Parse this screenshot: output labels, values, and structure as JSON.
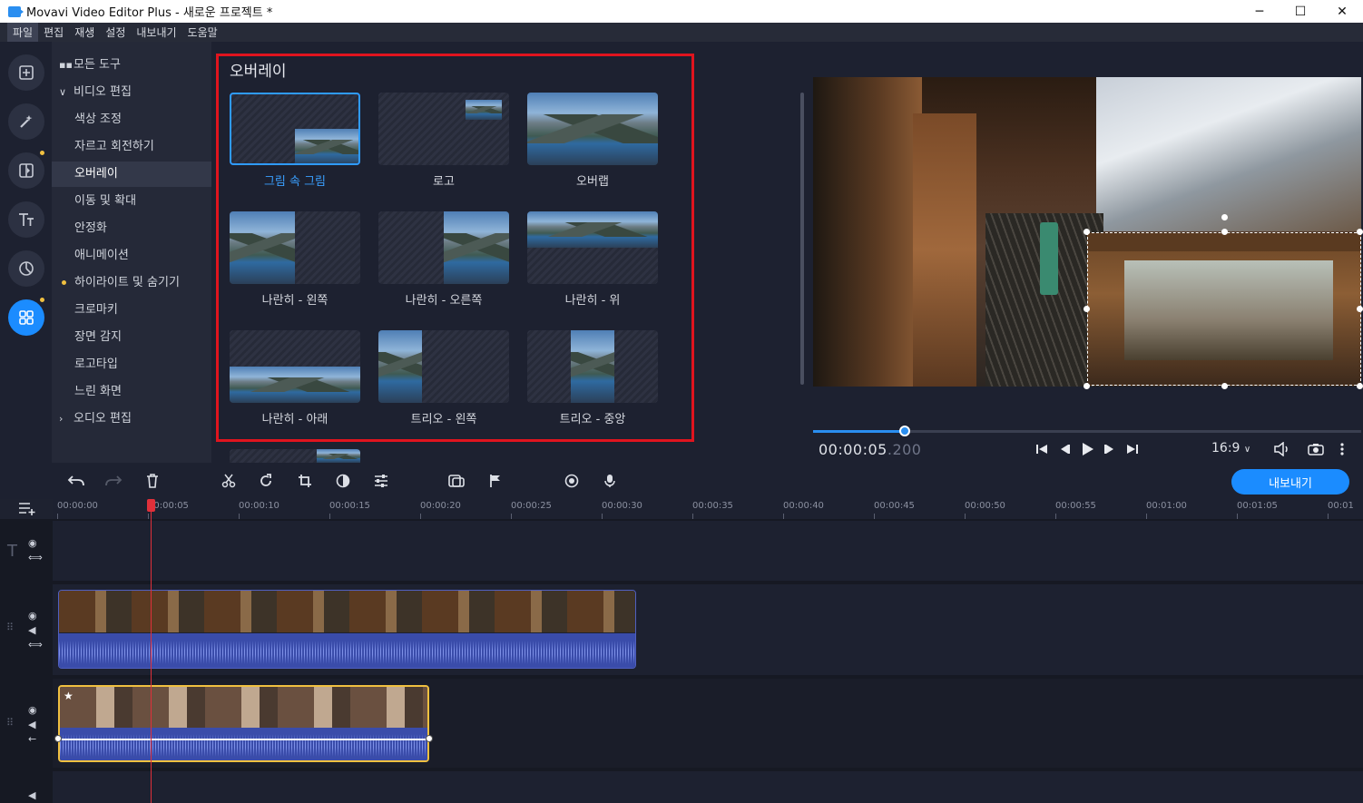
{
  "window": {
    "title": "Movavi Video Editor Plus - 새로운 프로젝트 *",
    "minimize": "─",
    "maximize": "☐",
    "close": "✕"
  },
  "menu": [
    "파일",
    "편집",
    "재생",
    "설정",
    "내보내기",
    "도움말"
  ],
  "rail_icons": [
    "import-icon",
    "magic-wand-icon",
    "transitions-icon",
    "titles-icon",
    "stickers-icon",
    "more-tools-icon"
  ],
  "tools": {
    "all_tools": "모든 도구",
    "video_edit": "비디오 편집",
    "items": [
      "색상 조정",
      "자르고 회전하기",
      "오버레이",
      "이동 및 확대",
      "안정화",
      "애니메이션",
      "하이라이트 및 숨기기",
      "크로마키",
      "장면 감지",
      "로고타입",
      "느린 화면"
    ],
    "audio_edit": "오디오 편집"
  },
  "overlay": {
    "title": "오버레이",
    "options": [
      "그림 속 그림",
      "로고",
      "오버랩",
      "나란히 - 왼쪽",
      "나란히 - 오른쪽",
      "나란히 - 위",
      "나란히 - 아래",
      "트리오 - 왼쪽",
      "트리오 - 중앙"
    ],
    "selected": "그림 속 그림"
  },
  "player": {
    "timecode_main": "00:00:05",
    "timecode_ms": ".200",
    "aspect_ratio": "16:9",
    "progress_fraction": 0.17
  },
  "timeline": {
    "export_label": "내보내기",
    "ruler": [
      "00:00:00",
      "00:00:05",
      "00:00:10",
      "00:00:15",
      "00:00:20",
      "00:00:25",
      "00:00:30",
      "00:00:35",
      "00:00:40",
      "00:00:45",
      "00:00:50",
      "00:00:55",
      "00:01:00",
      "00:01:05",
      "00:01"
    ]
  },
  "colors": {
    "accent": "#1b8cff",
    "highlight_box": "#e0141e",
    "playhead": "#e0303a",
    "overlay_clip_border": "#f0c040"
  }
}
